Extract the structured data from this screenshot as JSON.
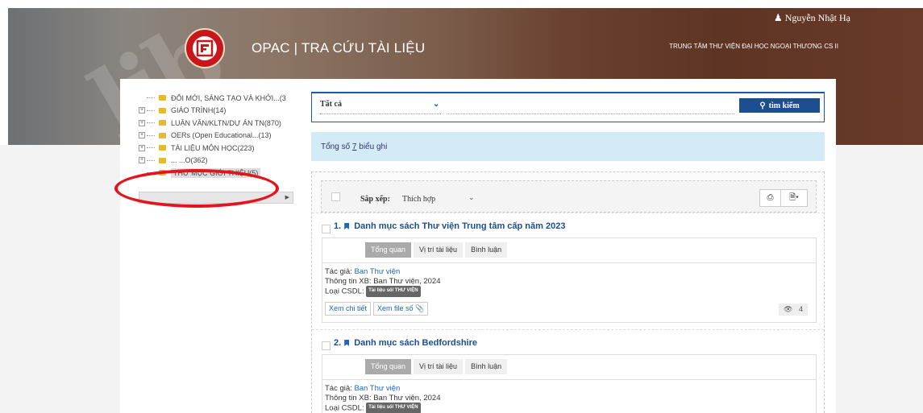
{
  "header": {
    "logo_letter": "FTU",
    "app_title": "OPAC | TRA CỨU TÀI LIỆU",
    "center_name": "TRUNG TÂM THƯ VIỆN ĐẠI HỌC NGOẠI THƯƠNG CS II",
    "user_name": "Nguyễn Nhật Hạ",
    "watermark": "lib"
  },
  "tree": {
    "items": [
      {
        "expander": "",
        "label": "ĐỔI MỚI, SÁNG TẠO VÀ KHỞI...(3"
      },
      {
        "expander": "+",
        "label": "GIÁO TRÌNH(14)"
      },
      {
        "expander": "+",
        "label": "LUẬN VĂN/KLTN/DỰ ÁN TN(870)"
      },
      {
        "expander": "+",
        "label": "OERs (Open Educational...(13)"
      },
      {
        "expander": "+",
        "label": "TÀI LIỆU MÔN HỌC(223)"
      },
      {
        "expander": "+",
        "label": "... ...O(362)"
      },
      {
        "expander": "",
        "label": "THƯ MỤC GIỚI THIỆU(5)"
      }
    ]
  },
  "search": {
    "scope_value": "Tất cả",
    "query_value": "",
    "button_label": "tìm kiếm"
  },
  "summary": {
    "prefix": "Tổng số",
    "count": "7",
    "suffix": "biểu ghi"
  },
  "sort": {
    "label": "Sắp xếp:",
    "value": "Thích hợp"
  },
  "results": [
    {
      "number": "1.",
      "title": "Danh mục sách Thư viện Trung tâm cấp năm 2023",
      "tabs": [
        "Tổng quan",
        "Vị trí tài liệu",
        "Bình luận"
      ],
      "author_label": "Tác giả:",
      "author": "Ban Thư viện",
      "publisher_line": "Thông tin XB: Ban Thư viện, 2024",
      "db_label": "Loại CSDL:",
      "db_badge": "Tài liệu số/ THƯ VIỆN",
      "view_detail": "Xem chi tiết",
      "view_file": "Xem file số",
      "views": "4"
    },
    {
      "number": "2.",
      "title": "Danh mục sách Bedfordshire",
      "tabs": [
        "Tổng quan",
        "Vị trí tài liệu",
        "Bình luận"
      ],
      "author_label": "Tác giả:",
      "author": "Ban Thư viện",
      "publisher_line": "Thông tin XB: Ban Thư viện, 2024",
      "db_label": "Loại CSDL:",
      "db_badge": "Tài liệu số/ THƯ VIỆN"
    }
  ],
  "colors": {
    "accent": "#1b4f8f",
    "annotation": "#e3141b",
    "info_bar": "#d3ebf6"
  }
}
